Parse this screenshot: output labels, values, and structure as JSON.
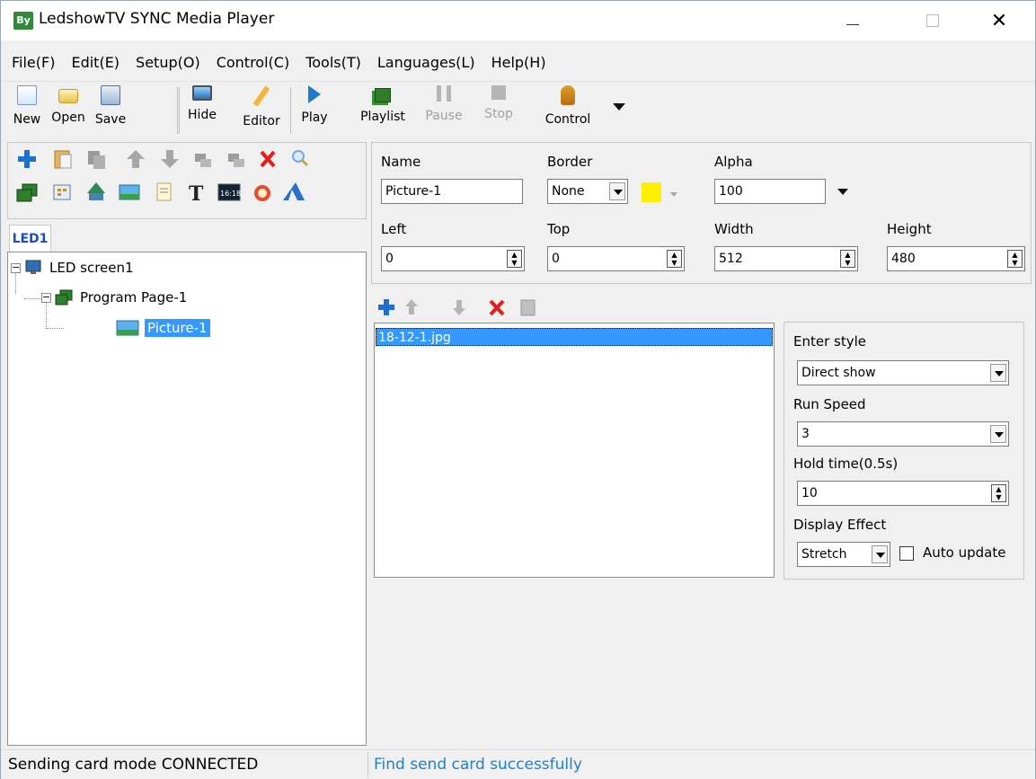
{
  "window": {
    "app_icon_text": "By",
    "title": "LedshowTV SYNC Media Player",
    "close_glyph": "✕"
  },
  "menu": [
    "File(F)",
    "Edit(E)",
    "Setup(O)",
    "Control(C)",
    "Tools(T)",
    "Languages(L)",
    "Help(H)"
  ],
  "toolbar": {
    "new": "New",
    "open": "Open",
    "save": "Save",
    "hide": "Hide",
    "editor": "Editor",
    "play": "Play",
    "playlist": "Playlist",
    "pause": "Pause",
    "stop": "Stop",
    "control": "Control"
  },
  "left_tools": {
    "row1_icons": [
      "add-icon",
      "paste-icon",
      "copy-icon",
      "move-up-icon",
      "move-down-icon",
      "arrange-icon",
      "arrange-2-icon",
      "delete-icon",
      "zoom-icon"
    ],
    "row2_icons": [
      "program-page-icon",
      "grid-icon",
      "weather-icon",
      "picture-icon",
      "document-icon",
      "text-icon",
      "clock-digital-icon",
      "alarm-clock-icon",
      "animated-text-icon"
    ],
    "clock_text": "16:18"
  },
  "tab": {
    "label": "LED1"
  },
  "tree": {
    "screen": "LED screen1",
    "page": "Program Page-1",
    "picture": "Picture-1",
    "expander_glyph": "−"
  },
  "props": {
    "name_label": "Name",
    "name_value": "Picture-1",
    "border_label": "Border",
    "border_value": "None",
    "border_color": "#ffee00",
    "alpha_label": "Alpha",
    "alpha_value": "100",
    "left_label": "Left",
    "left_value": "0",
    "top_label": "Top",
    "top_value": "0",
    "width_label": "Width",
    "width_value": "512",
    "height_label": "Height",
    "height_value": "480"
  },
  "file_list": {
    "items": [
      "18-12-1.jpg"
    ]
  },
  "effects": {
    "enter_style_label": "Enter style",
    "enter_style_value": "Direct show",
    "run_speed_label": "Run Speed",
    "run_speed_value": "3",
    "hold_time_label": "Hold time(0.5s)",
    "hold_time_value": "10",
    "display_effect_label": "Display Effect",
    "display_effect_value": "Stretch",
    "auto_update_label": "Auto update",
    "auto_update_checked": false
  },
  "status": {
    "left": "Sending card mode CONNECTED",
    "right": "Find send card successfully"
  },
  "colors": {
    "selection": "#3399ff",
    "status_link": "#1f7fd1",
    "tab_text": "#1c4db5"
  }
}
